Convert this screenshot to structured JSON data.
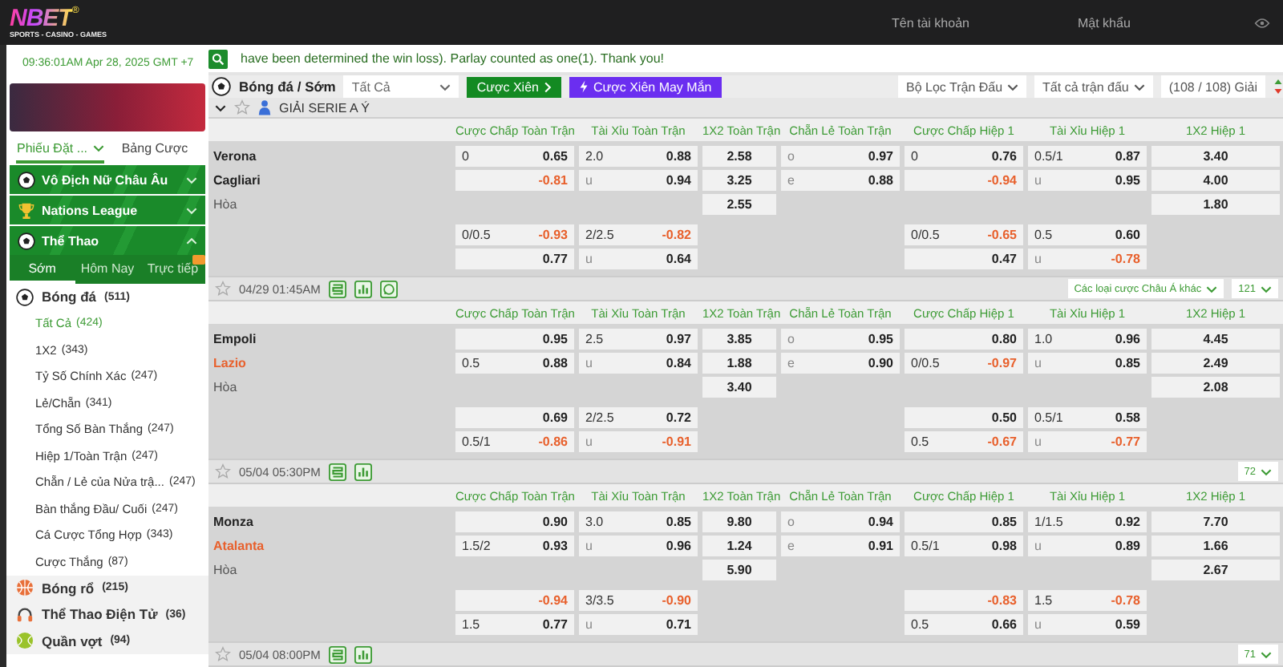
{
  "header": {
    "logo": "NBET",
    "logo_mark": "®",
    "tagline": "SPORTS - CASINO - GAMES",
    "username": {
      "placeholder": "Tên tài khoản"
    },
    "password": {
      "placeholder": "Mật khẩu"
    }
  },
  "clock": "09:36:01AM Apr 28, 2025 GMT +7",
  "marquee": "have been determined the win loss). Parlay counted as one(1). Thank you!",
  "sidebar": {
    "tabs": [
      {
        "label": "Phiếu Đặt ...",
        "selected": true
      },
      {
        "label": "Bảng Cược",
        "selected": false
      }
    ],
    "groups": [
      {
        "label": "Vô Địch Nữ Châu Âu",
        "kind": "soccer",
        "expanded": false
      },
      {
        "label": "Nations League",
        "kind": "trophy",
        "expanded": false
      },
      {
        "label": "Thể Thao",
        "kind": "soccer",
        "expanded": true
      }
    ],
    "subtabs": [
      {
        "label": "Sớm",
        "selected": true,
        "badge": false
      },
      {
        "label": "Hôm Nay",
        "selected": false,
        "badge": false
      },
      {
        "label": "Trực tiếp",
        "selected": false,
        "badge": true
      }
    ],
    "sports": [
      {
        "name": "Bóng đá",
        "count": "(511)",
        "kind": "soccer",
        "children": [
          {
            "name": "Tất Cả",
            "count": "(424)",
            "selected": true
          },
          {
            "name": "1X2",
            "count": "(343)",
            "selected": false
          },
          {
            "name": "Tỷ Số Chính Xác",
            "count": "(247)",
            "selected": false
          },
          {
            "name": "Lẻ/Chẵn",
            "count": "(341)",
            "selected": false
          },
          {
            "name": "Tổng Số Bàn Thắng",
            "count": "(247)",
            "selected": false
          },
          {
            "name": "Hiệp 1/Toàn Trận",
            "count": "(247)",
            "selected": false
          },
          {
            "name": "Chẵn / Lẻ của Nửa trậ...",
            "count": "(247)",
            "selected": false
          },
          {
            "name": "Bàn thắng Đầu/ Cuối",
            "count": "(247)",
            "selected": false
          },
          {
            "name": "Cá Cược Tổng Hợp",
            "count": "(343)",
            "selected": false
          },
          {
            "name": "Cược Thắng",
            "count": "(87)",
            "selected": false
          }
        ]
      },
      {
        "name": "Bóng rổ",
        "count": "(215)",
        "kind": "basketball"
      },
      {
        "name": "Thể Thao Điện Tử",
        "count": "(36)",
        "kind": "esports"
      },
      {
        "name": "Quần vợt",
        "count": "(94)",
        "kind": "tennis"
      }
    ]
  },
  "toolbar": {
    "sport": "Bóng đá / Sớm",
    "market": "Tất Cả",
    "parlay": "Cược Xiên",
    "lucky": "Cược Xiên May Mắn",
    "filter": "Bộ Lọc Trận Đấu",
    "matches": "Tất cả trận đấu",
    "leagues": "(108 / 108) Giải"
  },
  "league": {
    "name": "GIẢI SERIE A Ý"
  },
  "matches": [
    {
      "columns": [
        "Cược Chấp Toàn Trận",
        "Tài Xỉu Toàn Trận",
        "1X2 Toàn Trận",
        "Chẵn Lẻ Toàn Trận",
        "Cược Chấp Hiệp 1",
        "Tài Xỉu Hiệp 1",
        "1X2 Hiệp 1"
      ],
      "rows": [
        {
          "kind": "team",
          "name": "Verona",
          "highlighted": false,
          "cells": [
            {
              "kind": "pair",
              "line": "0",
              "odds": "0.65",
              "negative": false
            },
            {
              "kind": "pair",
              "line": "2.0",
              "odds": "0.88",
              "negative": false
            },
            {
              "kind": "single",
              "odds": "2.58"
            },
            {
              "kind": "pair",
              "line": "o",
              "odds": "0.97",
              "negative": false
            },
            {
              "kind": "pair",
              "line": "0",
              "odds": "0.76",
              "negative": false
            },
            {
              "kind": "pair",
              "line": "0.5/1",
              "odds": "0.87",
              "negative": false
            },
            {
              "kind": "single",
              "odds": "3.40"
            }
          ]
        },
        {
          "kind": "team",
          "name": "Cagliari",
          "highlighted": false,
          "cells": [
            {
              "kind": "pair",
              "odds": "-0.81",
              "negative": true
            },
            {
              "kind": "pair",
              "line": "u",
              "odds": "0.94",
              "negative": false
            },
            {
              "kind": "single",
              "odds": "3.25"
            },
            {
              "kind": "pair",
              "line": "e",
              "odds": "0.88",
              "negative": false
            },
            {
              "kind": "pair",
              "odds": "-0.94",
              "negative": true
            },
            {
              "kind": "pair",
              "line": "u",
              "odds": "0.95",
              "negative": false
            },
            {
              "kind": "single",
              "odds": "4.00"
            }
          ]
        },
        {
          "kind": "draw",
          "name": "Hòa",
          "cells": [
            {
              "kind": "empty"
            },
            {
              "kind": "empty"
            },
            {
              "kind": "single",
              "odds": "2.55"
            },
            {
              "kind": "empty"
            },
            {
              "kind": "empty"
            },
            {
              "kind": "empty"
            },
            {
              "kind": "single",
              "odds": "1.80"
            }
          ]
        },
        {
          "kind": "extra",
          "cells": [
            {
              "kind": "pair",
              "line": "0/0.5",
              "odds": "-0.93",
              "negative": true
            },
            {
              "kind": "pair",
              "line": "2/2.5",
              "odds": "-0.82",
              "negative": true
            },
            {
              "kind": "empty"
            },
            {
              "kind": "empty"
            },
            {
              "kind": "pair",
              "line": "0/0.5",
              "odds": "-0.65",
              "negative": true
            },
            {
              "kind": "pair",
              "line": "0.5",
              "odds": "0.60",
              "negative": false
            },
            {
              "kind": "empty"
            }
          ]
        },
        {
          "kind": "extra",
          "cells": [
            {
              "kind": "pair",
              "odds": "0.77",
              "negative": false
            },
            {
              "kind": "pair",
              "line": "u",
              "odds": "0.64",
              "negative": false
            },
            {
              "kind": "empty"
            },
            {
              "kind": "empty"
            },
            {
              "kind": "pair",
              "odds": "0.47",
              "negative": false
            },
            {
              "kind": "pair",
              "line": "u",
              "odds": "-0.78",
              "negative": true
            },
            {
              "kind": "empty"
            }
          ]
        }
      ],
      "footer": {
        "time": "04/29 01:45AM",
        "chat": true,
        "more": "Các loại cược Châu Á khác",
        "count": "121"
      }
    },
    {
      "columns": [
        "Cược Chấp Toàn Trận",
        "Tài Xỉu Toàn Trận",
        "1X2 Toàn Trận",
        "Chẵn Lẻ Toàn Trận",
        "Cược Chấp Hiệp 1",
        "Tài Xỉu Hiệp 1",
        "1X2 Hiệp 1"
      ],
      "rows": [
        {
          "kind": "team",
          "name": "Empoli",
          "highlighted": false,
          "cells": [
            {
              "kind": "pair",
              "odds": "0.95",
              "negative": false
            },
            {
              "kind": "pair",
              "line": "2.5",
              "odds": "0.97",
              "negative": false
            },
            {
              "kind": "single",
              "odds": "3.85"
            },
            {
              "kind": "pair",
              "line": "o",
              "odds": "0.95",
              "negative": false
            },
            {
              "kind": "pair",
              "odds": "0.80",
              "negative": false
            },
            {
              "kind": "pair",
              "line": "1.0",
              "odds": "0.96",
              "negative": false
            },
            {
              "kind": "single",
              "odds": "4.45"
            }
          ]
        },
        {
          "kind": "team",
          "name": "Lazio",
          "highlighted": true,
          "cells": [
            {
              "kind": "pair",
              "line": "0.5",
              "odds": "0.88",
              "negative": false
            },
            {
              "kind": "pair",
              "line": "u",
              "odds": "0.84",
              "negative": false
            },
            {
              "kind": "single",
              "odds": "1.88"
            },
            {
              "kind": "pair",
              "line": "e",
              "odds": "0.90",
              "negative": false
            },
            {
              "kind": "pair",
              "line": "0/0.5",
              "odds": "-0.97",
              "negative": true
            },
            {
              "kind": "pair",
              "line": "u",
              "odds": "0.85",
              "negative": false
            },
            {
              "kind": "single",
              "odds": "2.49"
            }
          ]
        },
        {
          "kind": "draw",
          "name": "Hòa",
          "cells": [
            {
              "kind": "empty"
            },
            {
              "kind": "empty"
            },
            {
              "kind": "single",
              "odds": "3.40"
            },
            {
              "kind": "empty"
            },
            {
              "kind": "empty"
            },
            {
              "kind": "empty"
            },
            {
              "kind": "single",
              "odds": "2.08"
            }
          ]
        },
        {
          "kind": "extra",
          "cells": [
            {
              "kind": "pair",
              "odds": "0.69",
              "negative": false
            },
            {
              "kind": "pair",
              "line": "2/2.5",
              "odds": "0.72",
              "negative": false
            },
            {
              "kind": "empty"
            },
            {
              "kind": "empty"
            },
            {
              "kind": "pair",
              "odds": "0.50",
              "negative": false
            },
            {
              "kind": "pair",
              "line": "0.5/1",
              "odds": "0.58",
              "negative": false
            },
            {
              "kind": "empty"
            }
          ]
        },
        {
          "kind": "extra",
          "cells": [
            {
              "kind": "pair",
              "line": "0.5/1",
              "odds": "-0.86",
              "negative": true
            },
            {
              "kind": "pair",
              "line": "u",
              "odds": "-0.91",
              "negative": true
            },
            {
              "kind": "empty"
            },
            {
              "kind": "empty"
            },
            {
              "kind": "pair",
              "line": "0.5",
              "odds": "-0.67",
              "negative": true
            },
            {
              "kind": "pair",
              "line": "u",
              "odds": "-0.77",
              "negative": true
            },
            {
              "kind": "empty"
            }
          ]
        }
      ],
      "footer": {
        "time": "05/04 05:30PM",
        "chat": false,
        "count": "72"
      }
    },
    {
      "columns": [
        "Cược Chấp Toàn Trận",
        "Tài Xỉu Toàn Trận",
        "1X2 Toàn Trận",
        "Chẵn Lẻ Toàn Trận",
        "Cược Chấp Hiệp 1",
        "Tài Xỉu Hiệp 1",
        "1X2 Hiệp 1"
      ],
      "rows": [
        {
          "kind": "team",
          "name": "Monza",
          "highlighted": false,
          "cells": [
            {
              "kind": "pair",
              "odds": "0.90",
              "negative": false
            },
            {
              "kind": "pair",
              "line": "3.0",
              "odds": "0.85",
              "negative": false
            },
            {
              "kind": "single",
              "odds": "9.80"
            },
            {
              "kind": "pair",
              "line": "o",
              "odds": "0.94",
              "negative": false
            },
            {
              "kind": "pair",
              "odds": "0.85",
              "negative": false
            },
            {
              "kind": "pair",
              "line": "1/1.5",
              "odds": "0.92",
              "negative": false
            },
            {
              "kind": "single",
              "odds": "7.70"
            }
          ]
        },
        {
          "kind": "team",
          "name": "Atalanta",
          "highlighted": true,
          "cells": [
            {
              "kind": "pair",
              "line": "1.5/2",
              "odds": "0.93",
              "negative": false
            },
            {
              "kind": "pair",
              "line": "u",
              "odds": "0.96",
              "negative": false
            },
            {
              "kind": "single",
              "odds": "1.24"
            },
            {
              "kind": "pair",
              "line": "e",
              "odds": "0.91",
              "negative": false
            },
            {
              "kind": "pair",
              "line": "0.5/1",
              "odds": "0.98",
              "negative": false
            },
            {
              "kind": "pair",
              "line": "u",
              "odds": "0.89",
              "negative": false
            },
            {
              "kind": "single",
              "odds": "1.66"
            }
          ]
        },
        {
          "kind": "draw",
          "name": "Hòa",
          "cells": [
            {
              "kind": "empty"
            },
            {
              "kind": "empty"
            },
            {
              "kind": "single",
              "odds": "5.90"
            },
            {
              "kind": "empty"
            },
            {
              "kind": "empty"
            },
            {
              "kind": "empty"
            },
            {
              "kind": "single",
              "odds": "2.67"
            }
          ]
        },
        {
          "kind": "extra",
          "cells": [
            {
              "kind": "pair",
              "odds": "-0.94",
              "negative": true
            },
            {
              "kind": "pair",
              "line": "3/3.5",
              "odds": "-0.90",
              "negative": true
            },
            {
              "kind": "empty"
            },
            {
              "kind": "empty"
            },
            {
              "kind": "pair",
              "odds": "-0.83",
              "negative": true
            },
            {
              "kind": "pair",
              "line": "1.5",
              "odds": "-0.78",
              "negative": true
            },
            {
              "kind": "empty"
            }
          ]
        },
        {
          "kind": "extra",
          "cells": [
            {
              "kind": "pair",
              "line": "1.5",
              "odds": "0.77",
              "negative": false
            },
            {
              "kind": "pair",
              "line": "u",
              "odds": "0.71",
              "negative": false
            },
            {
              "kind": "empty"
            },
            {
              "kind": "empty"
            },
            {
              "kind": "pair",
              "line": "0.5",
              "odds": "0.66",
              "negative": false
            },
            {
              "kind": "pair",
              "line": "u",
              "odds": "0.59",
              "negative": false
            },
            {
              "kind": "empty"
            }
          ]
        }
      ],
      "footer": {
        "time": "05/04 08:00PM",
        "chat": false,
        "count": "71"
      }
    }
  ]
}
